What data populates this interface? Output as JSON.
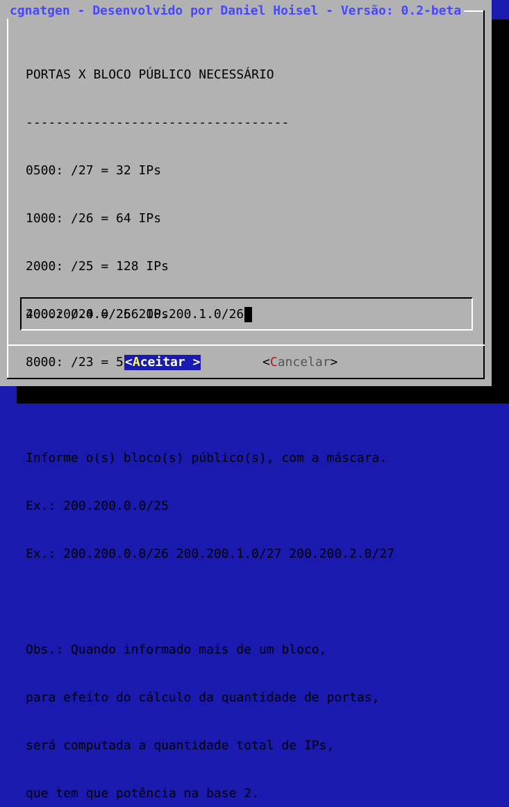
{
  "window": {
    "title": "cgnatgen - Desenvolvido por Daniel Hoisel - Versão: 0.2-beta"
  },
  "body": {
    "lines": [
      "PORTAS X BLOCO PÚBLICO NECESSÁRIO",
      "-----------------------------------",
      "0500: /27 = 32 IPs",
      "1000: /26 = 64 IPs",
      "2000: /25 = 128 IPs",
      "4000: /24 = 256 IPs",
      "8000: /23 = 512 IPs",
      "",
      "Informe o(s) bloco(s) público(s), com a máscara.",
      "Ex.: 200.200.0.0/25",
      "Ex.: 200.200.0.0/26 200.200.1.0/27 200.200.2.0/27",
      "",
      "Obs.: Quando informado mais de um bloco,",
      "para efeito do cálculo da quantidade de portas,",
      "será computada a quantidade total de IPs,",
      "que tem que potência na base 2."
    ]
  },
  "input": {
    "value": "200.200.0.0/26 200.200.1.0/26"
  },
  "buttons": {
    "ok": {
      "open": "<",
      "hotkey": "A",
      "rest": "ceitar",
      "close": " >"
    },
    "cancel": {
      "open": "<",
      "hotkey": "C",
      "rest": "ancelar",
      "close": ">"
    }
  },
  "colors": {
    "screen_background": "#1a1aaf",
    "dialog_background": "#b2b2b2",
    "title": "#4747ff",
    "selected_button_bg": "#1a1aaf",
    "hotkey_selected": "#ffff54",
    "hotkey_unselected": "#b21818"
  }
}
